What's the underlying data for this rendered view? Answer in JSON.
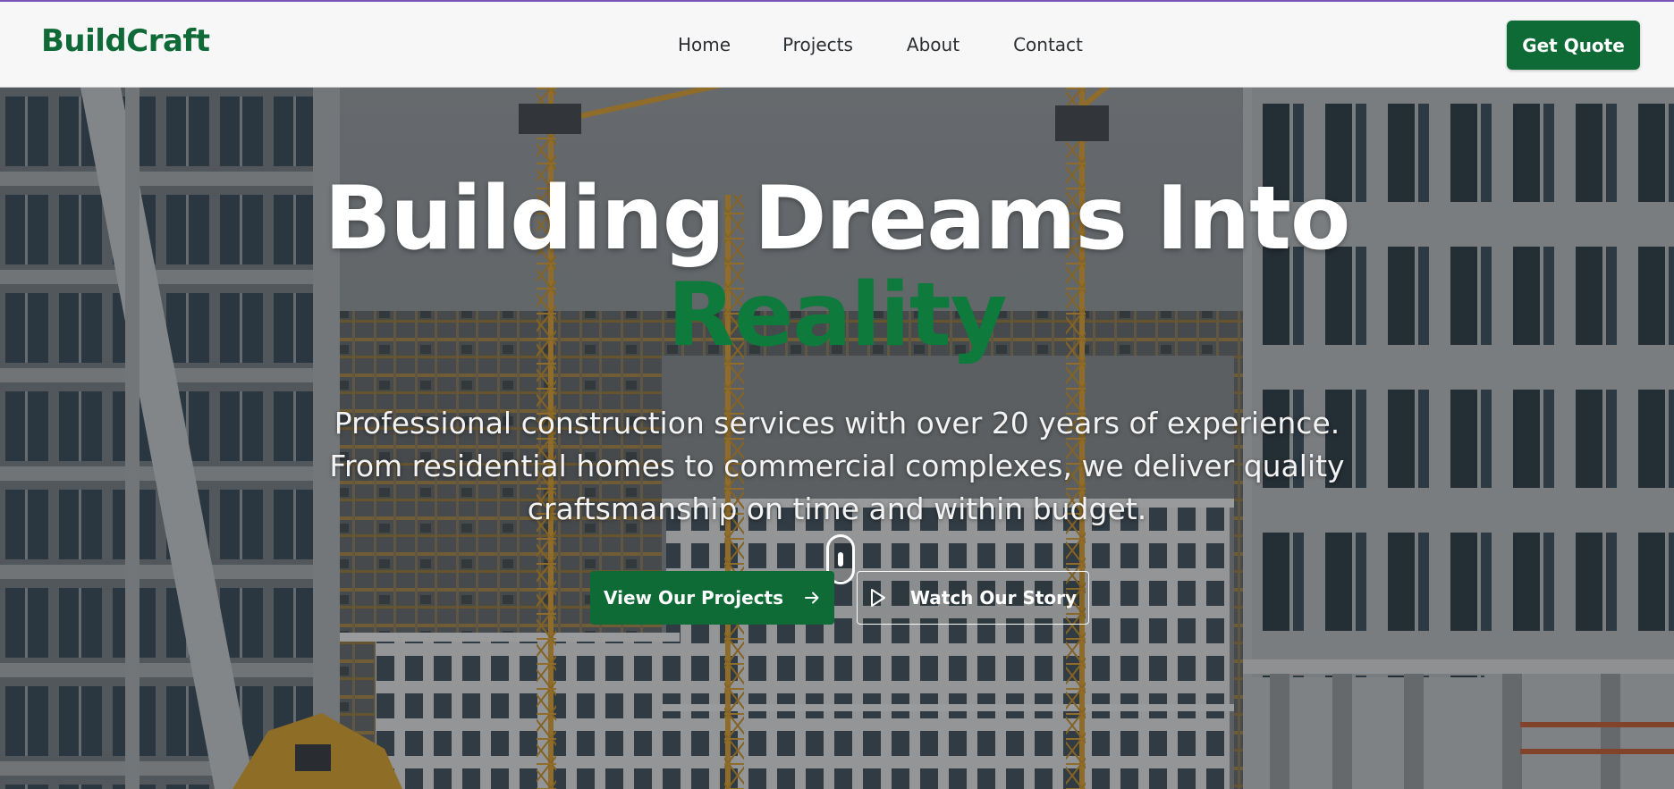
{
  "brand": {
    "name": "BuildCraft",
    "color": "#0f6a37"
  },
  "nav": {
    "links": [
      {
        "label": "Home"
      },
      {
        "label": "Projects"
      },
      {
        "label": "About"
      },
      {
        "label": "Contact"
      }
    ],
    "cta_label": "Get Quote"
  },
  "hero": {
    "title": "Building Dreams Into",
    "title_accent": "Reality",
    "subtitle": "Professional construction services with over 20 years of experience. From residential homes to commercial complexes, we deliver quality craftsmanship on time and within budget.",
    "primary_button": {
      "label": "View Our Projects",
      "icon": "arrow-right-icon"
    },
    "secondary_button": {
      "label": "Watch Our Story",
      "icon": "play-icon"
    },
    "scroll_icon": "mouse-scroll-icon",
    "background": "construction-site-photo"
  },
  "colors": {
    "accent": "#0e6b36",
    "accent_text": "#0e7a3c",
    "header_bg": "#f7f7f7",
    "text_light": "#ffffff"
  }
}
